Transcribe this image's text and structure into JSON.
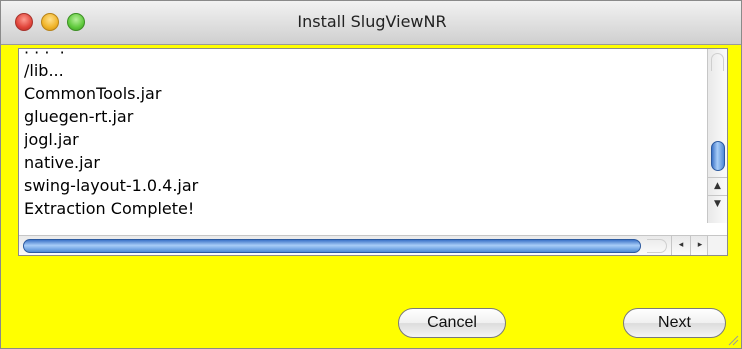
{
  "window": {
    "title": "Install SlugViewNR",
    "background": "#ffff00"
  },
  "log": {
    "partial_top": "",
    "lines": [
      "/lib...",
      "CommonTools.jar",
      "gluegen-rt.jar",
      "jogl.jar",
      "native.jar",
      "swing-layout-1.0.4.jar",
      "Extraction Complete!"
    ]
  },
  "icons": {
    "scroll_up": "▲",
    "scroll_down": "▼",
    "scroll_left": "◂",
    "scroll_right": "▸"
  },
  "buttons": {
    "cancel": "Cancel",
    "next": "Next"
  },
  "colors": {
    "scroll_thumb": "#4f8ad6"
  }
}
